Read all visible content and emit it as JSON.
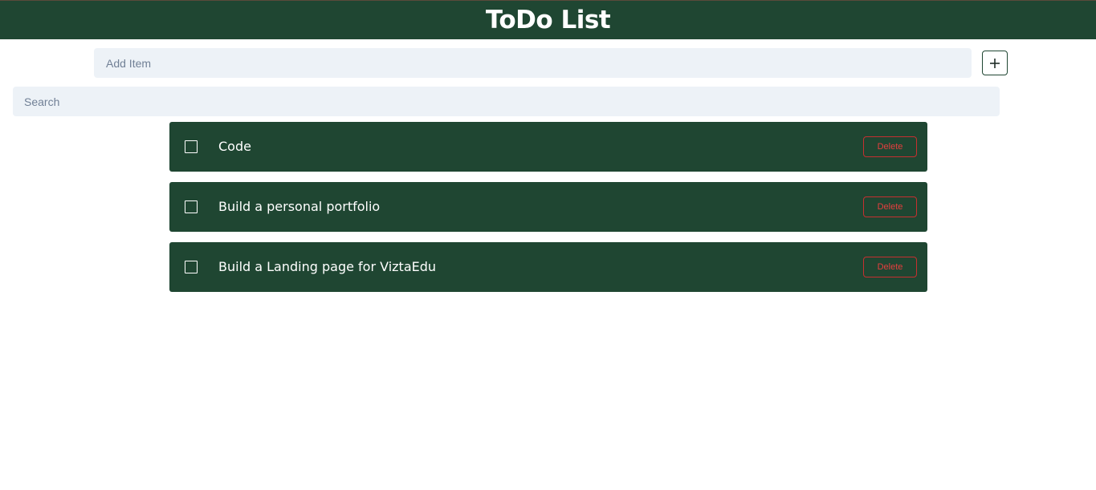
{
  "header": {
    "title": "ToDo List"
  },
  "add": {
    "placeholder": "Add Item",
    "button_icon": "plus-icon"
  },
  "search": {
    "placeholder": "Search"
  },
  "todos": [
    {
      "text": "Code",
      "delete_label": "Delete",
      "checked": false
    },
    {
      "text": "Build a personal portfolio",
      "delete_label": "Delete",
      "checked": false
    },
    {
      "text": "Build a Landing page for ViztaEdu",
      "delete_label": "Delete",
      "checked": false
    }
  ],
  "colors": {
    "primary": "#1f4632",
    "input_bg": "#edf2f7",
    "delete": "#e53e3e"
  }
}
